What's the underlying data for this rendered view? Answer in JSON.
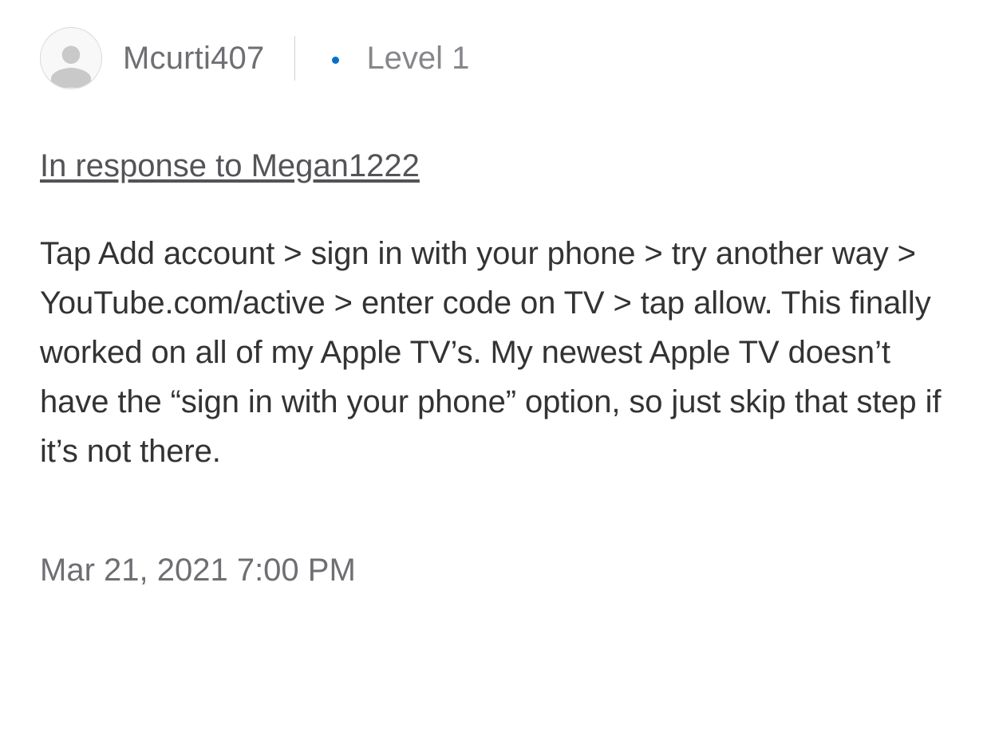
{
  "post": {
    "author": {
      "username": "Mcurti407",
      "level": "Level 1"
    },
    "in_response_to": "In response to Megan1222",
    "body": "Tap Add account > sign in with your phone > try another way > YouTube.com/active > enter code on TV > tap allow. This finally worked on all of my Apple TV’s. My newest Apple TV doesn’t have the “sign in with your phone” option, so just skip that step if it’s not there.",
    "timestamp": "Mar 21, 2021 7:00 PM"
  }
}
